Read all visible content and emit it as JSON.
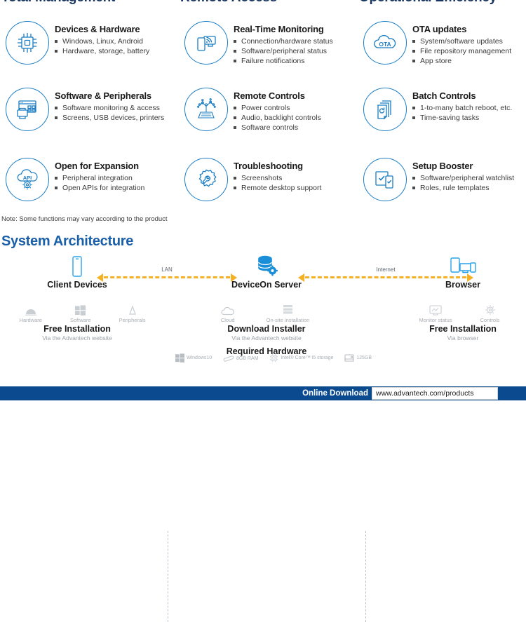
{
  "columns": [
    {
      "title": "Total Management"
    },
    {
      "title": "Remote Access"
    },
    {
      "title": "Operational Efficiency"
    }
  ],
  "features": [
    {
      "icon": "chip-icon",
      "title": "Devices & Hardware",
      "bullets": [
        "Windows, Linux, Android",
        "Hardware, storage, battery"
      ]
    },
    {
      "icon": "real-time-monitoring-icon",
      "title": "Real-Time Monitoring",
      "bullets": [
        "Connection/hardware status",
        "Software/peripheral status",
        "Failure notifications"
      ]
    },
    {
      "icon": "ota-cloud-icon",
      "title": "OTA updates",
      "bullets": [
        "System/software updates",
        "File repository management",
        "App store"
      ]
    },
    {
      "icon": "software-peripherals-icon",
      "title": "Software & Peripherals",
      "bullets": [
        "Software monitoring & access",
        "Screens, USB devices, printers"
      ]
    },
    {
      "icon": "remote-controls-circuit-icon",
      "title": "Remote Controls",
      "bullets": [
        "Power controls",
        "Audio, backlight controls",
        "Software controls"
      ]
    },
    {
      "icon": "batch-controls-stack-icon",
      "title": "Batch Controls",
      "bullets": [
        "1-to-many batch reboot, etc.",
        "Time-saving tasks"
      ]
    },
    {
      "icon": "api-cloud-gear-icon",
      "title": "Open for Expansion",
      "bullets": [
        "Peripheral integration",
        "Open APIs for integration"
      ]
    },
    {
      "icon": "troubleshooting-gear-wrench-icon",
      "title": "Troubleshooting",
      "bullets": [
        "Screenshots",
        "Remote desktop support"
      ]
    },
    {
      "icon": "setup-booster-checklist-icon",
      "title": "Setup Booster",
      "bullets": [
        "Software/peripheral watchlist",
        "Roles, rule templates"
      ]
    }
  ],
  "note": "Note: Some functions may vary according to the product",
  "architecture": {
    "section_title": "System Architecture",
    "nodes": [
      {
        "id": "client",
        "icon": "mobile-device-icon",
        "label": "Client Devices"
      },
      {
        "id": "server",
        "icon": "database-gear-icon",
        "label": "DeviceOn Server"
      },
      {
        "id": "browser",
        "icon": "multi-device-browser-icon",
        "label": "Browser"
      }
    ],
    "links": [
      {
        "id": "lan",
        "label": "LAN"
      },
      {
        "id": "internet",
        "label": "Internet"
      }
    ],
    "client_sub": [
      {
        "icon": "android-icon",
        "label": "Hardware"
      },
      {
        "icon": "windows-icon",
        "label": "Software"
      },
      {
        "icon": "peripherals-icon",
        "label": "Peripherals"
      }
    ],
    "server_sub": [
      {
        "icon": "cloud-icon",
        "label": "Cloud"
      },
      {
        "icon": "server-rack-icon",
        "label": "On-site installation"
      }
    ],
    "browser_sub": [
      {
        "icon": "monitor-icon",
        "label": "Monitor status"
      },
      {
        "icon": "controls-gear-icon",
        "label": "Controls"
      }
    ],
    "captions": [
      {
        "id": "client",
        "title": "Free Installation",
        "subtitle": "Via the Advantech website"
      },
      {
        "id": "server",
        "title": "Download Installer",
        "subtitle": "Via the Advantech website"
      },
      {
        "id": "browser",
        "title": "Free Installation",
        "subtitle": "Via browser"
      }
    ],
    "required_hardware_title": "Required Hardware",
    "required_hardware": [
      {
        "icon": "windows-icon",
        "label": "Windows10"
      },
      {
        "icon": "ram-icon",
        "label": "8GB RAM"
      },
      {
        "icon": "cpu-icon",
        "label": "Intel® Core™ i5 storage"
      },
      {
        "icon": "storage-icon",
        "label": "125GB"
      }
    ]
  },
  "footer": {
    "label": "Online Download",
    "url": "www.advantech.com/products"
  },
  "colors": {
    "brand_blue": "#1a7dc4",
    "dark_blue": "#17355e",
    "footer_blue": "#0b4a8f",
    "arrow_yellow": "#f5b123",
    "muted_gray": "#a9aeb3"
  }
}
